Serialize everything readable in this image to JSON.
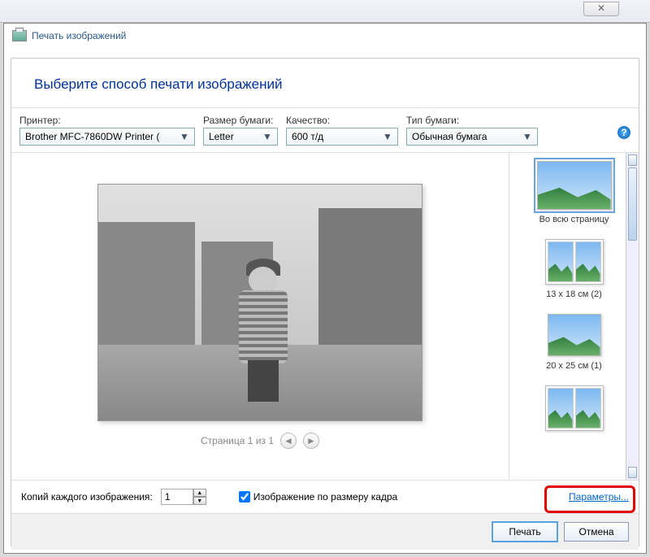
{
  "window": {
    "close_glyph": "✕"
  },
  "dialog_title": "Печать изображений",
  "heading": "Выберите способ печати изображений",
  "labels": {
    "printer": "Принтер:",
    "paper_size": "Размер бумаги:",
    "quality": "Качество:",
    "paper_type": "Тип бумаги:"
  },
  "values": {
    "printer": "Brother MFC-7860DW Printer ( ",
    "paper_size": "Letter",
    "quality": "600 т/д",
    "paper_type": "Обычная бумага"
  },
  "help_glyph": "?",
  "page_nav": {
    "text": "Страница 1 из 1",
    "prev": "◄",
    "next": "►"
  },
  "layouts": [
    {
      "key": "full",
      "label": "Во всю страницу",
      "selected": true,
      "style": "full"
    },
    {
      "key": "13x18",
      "label": "13 x 18 см (2)",
      "selected": false,
      "style": "pair"
    },
    {
      "key": "20x25",
      "label": "20 x 25 см (1)",
      "selected": false,
      "style": "single"
    },
    {
      "key": "next",
      "label": "",
      "selected": false,
      "style": "pair"
    }
  ],
  "copies": {
    "label": "Копий каждого изображения:",
    "value": "1",
    "up": "▲",
    "down": "▼"
  },
  "fit_checkbox": {
    "label": "Изображение по размеру кадра",
    "checked": true
  },
  "params_link": "Параметры...",
  "buttons": {
    "print": "Печать",
    "cancel": "Отмена"
  }
}
